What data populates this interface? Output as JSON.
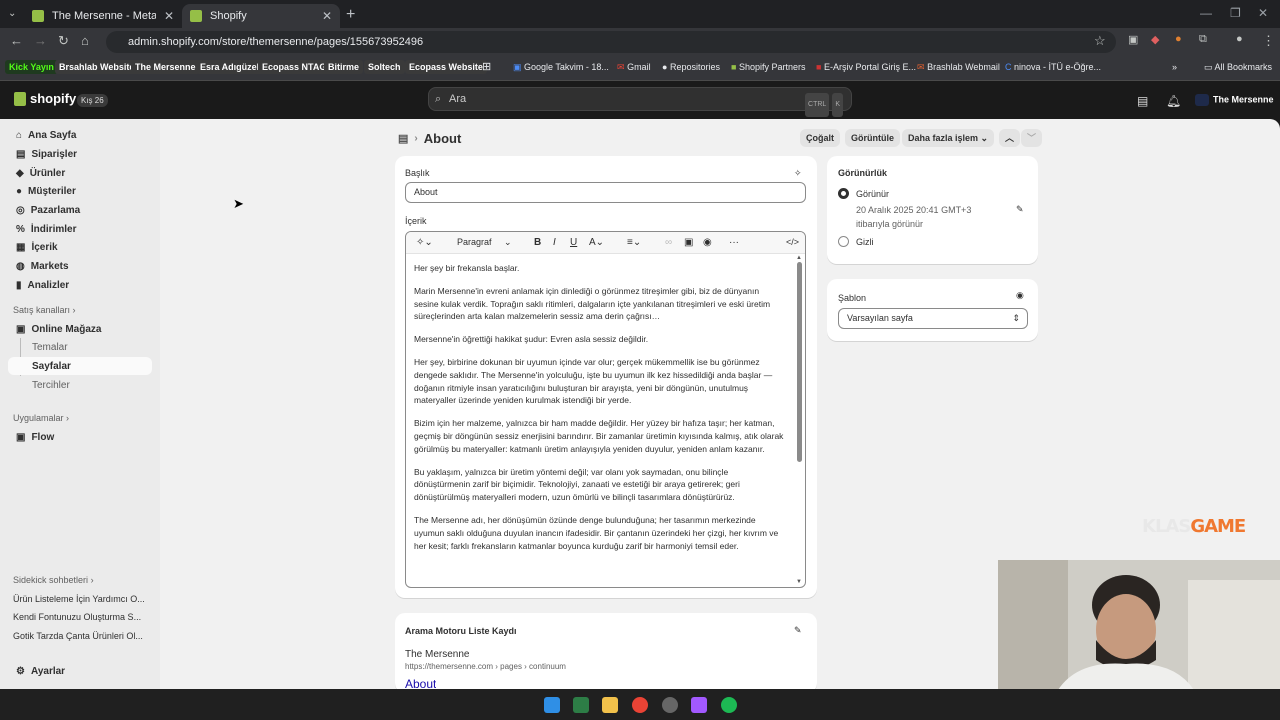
{
  "browser": {
    "tabs": [
      {
        "title": "The Mersenne - Meta nesne tan"
      },
      {
        "title": "Shopify"
      }
    ],
    "url": "admin.shopify.com/store/themersenne/pages/155673952496",
    "bookmarks": [
      "Kick Yayın",
      "Brsahlab Website",
      "The Mersenne",
      "Esra Adıgüzel",
      "Ecopass NTAG",
      "Bitirme",
      "Soltech",
      "Ecopass Website",
      "Google Takvim - 18...",
      "Gmail",
      "Repositories",
      "Shopify Partners",
      "E-Arşiv Portal Giriş E...",
      "Brashlab Webmail",
      "ninova - İTÜ e-Öğre..."
    ],
    "all_bookmarks": "All Bookmarks"
  },
  "topbar": {
    "logo": "shopify",
    "badge": "Kış 26",
    "search_placeholder": "Ara",
    "kbd1": "CTRL",
    "kbd2": "K",
    "store": "The Mersenne"
  },
  "nav": {
    "items": [
      "Ana Sayfa",
      "Siparişler",
      "Ürünler",
      "Müşteriler",
      "Pazarlama",
      "İndirimler",
      "İçerik",
      "Markets",
      "Analizler"
    ],
    "sales_channels": "Satış kanalları",
    "online_store": "Online Mağaza",
    "subitems": [
      "Temalar",
      "Sayfalar",
      "Tercihler"
    ],
    "apps": "Uygulamalar",
    "flow": "Flow",
    "sidekick": "Sidekick sohbetleri",
    "chats": [
      "Ürün Listeleme İçin Yardımcı O...",
      "Kendi Fontunuzu Oluşturma S...",
      "Gotik Tarzda Çanta Ürünleri Ol..."
    ],
    "settings": "Ayarlar"
  },
  "page": {
    "title": "About",
    "actions": {
      "duplicate": "Çoğalt",
      "view": "Görüntüle",
      "more": "Daha fazla işlem"
    },
    "title_label": "Başlık",
    "title_value": "About",
    "content_label": "İçerik",
    "format": "Paragraf",
    "paragraphs": [
      "Her şey bir frekansla başlar.",
      "Marin Mersenne'in evreni anlamak için dinlediği o görünmez titreşimler gibi, biz de dünyanın sesine kulak verdik.  Toprağın saklı ritimleri, dalgaların içte yankılanan titreşimleri ve eski üretim süreçlerinden arta kalan malzemelerin sessiz ama derin çağrısı…",
      "Mersenne'in öğrettiği hakikat şudur: Evren asla sessiz değildir.",
      "Her şey, birbirine dokunan bir uyumun içinde var olur; gerçek mükemmellik ise bu görünmez dengede saklıdır.  The Mersenne'in yolculuğu, işte bu uyumun ilk kez hissedildiği anda başlar —  doğanın ritmiyle insan yaratıcılığını buluşturan bir arayışta, yeni bir döngünün, unutulmuş materyaller üzerinde yeniden kurulmak istendiği bir yerde.",
      "Bizim için her malzeme, yalnızca bir ham madde değildir.  Her yüzey bir hafıza taşır; her katman, geçmiş bir döngünün sessiz enerjisini barındırır.  Bir zamanlar üretimin kıyısında kalmış, atık olarak görülmüş bu materyaller:  katmanlı üretim anlayışıyla yeniden duyulur, yeniden anlam kazanır.",
      "Bu yaklaşım, yalnızca bir üretim yöntemi değil;  var olanı yok saymadan, onu bilinçle dönüştürmenin zarif bir biçimidir.  Teknolojiyi, zanaati ve estetiği bir araya getirerek;  geri dönüştürülmüş materyalleri modern, uzun ömürlü ve bilinçli tasarımlara dönüştürürüz.",
      "The Mersenne adı, her dönüşümün özünde denge bulunduğuna;  her tasarımın merkezinde uyumun saklı olduğuna duyulan inancın ifadesidir.  Bir çantanın üzerindeki her çizgi, her kıvrım ve her kesit;  farklı frekansların katmanlar boyunca kurduğu zarif bir harmoniyi temsil eder."
    ],
    "seo": {
      "heading": "Arama Motoru Liste Kaydı",
      "site": "The Mersenne",
      "url": "https://themersenne.com › pages › continuum",
      "title": "About"
    },
    "visibility": {
      "heading": "Görünürlük",
      "visible": "Görünür",
      "date": "20 Aralık 2025 20:41 GMT+3",
      "date2": "itibarıyla görünür",
      "hidden": "Gizli",
      "selected": "Görünür"
    },
    "template": {
      "heading": "Şablon",
      "value": "Varsayılan sayfa"
    }
  },
  "overlay": {
    "brand1": "KLAS",
    "brand2": "GAME"
  }
}
